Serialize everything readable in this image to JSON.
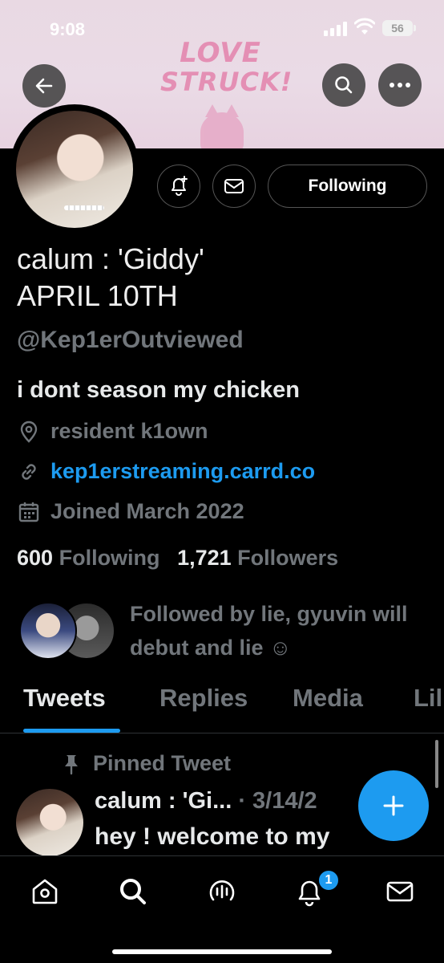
{
  "status_bar": {
    "time": "9:08",
    "battery": "56"
  },
  "banner": {
    "art_line1": "LOVE",
    "art_line2": "STRUCK!"
  },
  "profile": {
    "display_name_line1": "calum : 'Giddy'",
    "display_name_line2": "APRIL 10TH",
    "handle": "@Kep1erOutviewed",
    "bio": "i dont season my chicken",
    "location": "resident k1own",
    "website": "kep1erstreaming.carrd.co",
    "joined": "Joined March 2022",
    "following_count": "600",
    "following_label": "Following",
    "followers_count": "1,721",
    "followers_label": "Followers",
    "followed_by": "Followed by lie, gyuvin will debut and lie ☺"
  },
  "actions": {
    "following_button": "Following"
  },
  "tabs": [
    {
      "label": "Tweets",
      "active": true
    },
    {
      "label": "Replies",
      "active": false
    },
    {
      "label": "Media",
      "active": false
    },
    {
      "label": "Lil",
      "active": false
    }
  ],
  "pinned_tweet": {
    "pinned_label": "Pinned Tweet",
    "author": "calum : 'Gi...",
    "date": " · 3/14/2",
    "text": "hey ! welcome to my"
  },
  "bottom_nav": {
    "notification_badge": "1"
  },
  "colors": {
    "accent": "#1d9bf0",
    "muted": "#71767b",
    "text": "#e7e9ea",
    "background": "#000000"
  }
}
